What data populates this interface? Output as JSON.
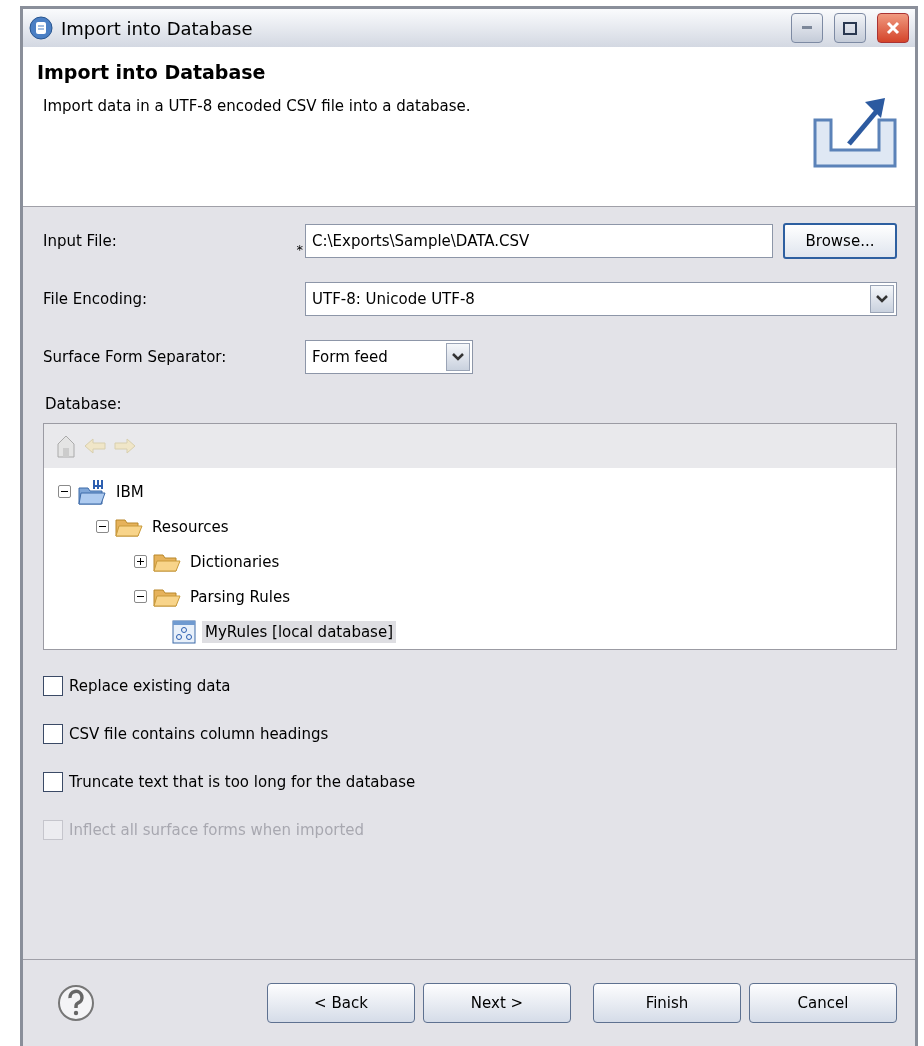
{
  "window": {
    "title": "Import into Database"
  },
  "header": {
    "title": "Import into Database",
    "description": "Import data in a UTF-8 encoded CSV file into a database."
  },
  "form": {
    "input_file": {
      "label": "Input File:",
      "required_mark": "*",
      "value": "C:\\Exports\\Sample\\DATA.CSV",
      "button": "Browse..."
    },
    "file_encoding": {
      "label": "File Encoding:",
      "value": "UTF-8: Unicode UTF-8"
    },
    "separator": {
      "label": "Surface Form Separator:",
      "value": "Form feed"
    },
    "database": {
      "label": "Database:"
    }
  },
  "tree": [
    {
      "label": "IBM",
      "kind": "server",
      "expanded": true,
      "selected": false,
      "children": [
        {
          "label": "Resources",
          "kind": "folder",
          "expanded": true,
          "selected": false,
          "children": [
            {
              "label": "Dictionaries",
              "kind": "folder",
              "expanded": false,
              "selected": false
            },
            {
              "label": "Parsing Rules",
              "kind": "folder",
              "expanded": true,
              "selected": false,
              "children": [
                {
                  "label": "MyRules [local database]",
                  "kind": "rules",
                  "selected": true
                }
              ]
            }
          ]
        }
      ]
    }
  ],
  "options": [
    {
      "label": "Replace existing data",
      "checked": false,
      "disabled": false
    },
    {
      "label": "CSV file contains column headings",
      "checked": false,
      "disabled": false
    },
    {
      "label": "Truncate text that is too long for the database",
      "checked": false,
      "disabled": false
    },
    {
      "label": "Inflect all surface forms when imported",
      "checked": false,
      "disabled": true
    }
  ],
  "buttons": [
    {
      "label": "< Back"
    },
    {
      "label": "Next >"
    },
    {
      "label": "Finish"
    },
    {
      "label": "Cancel"
    }
  ]
}
